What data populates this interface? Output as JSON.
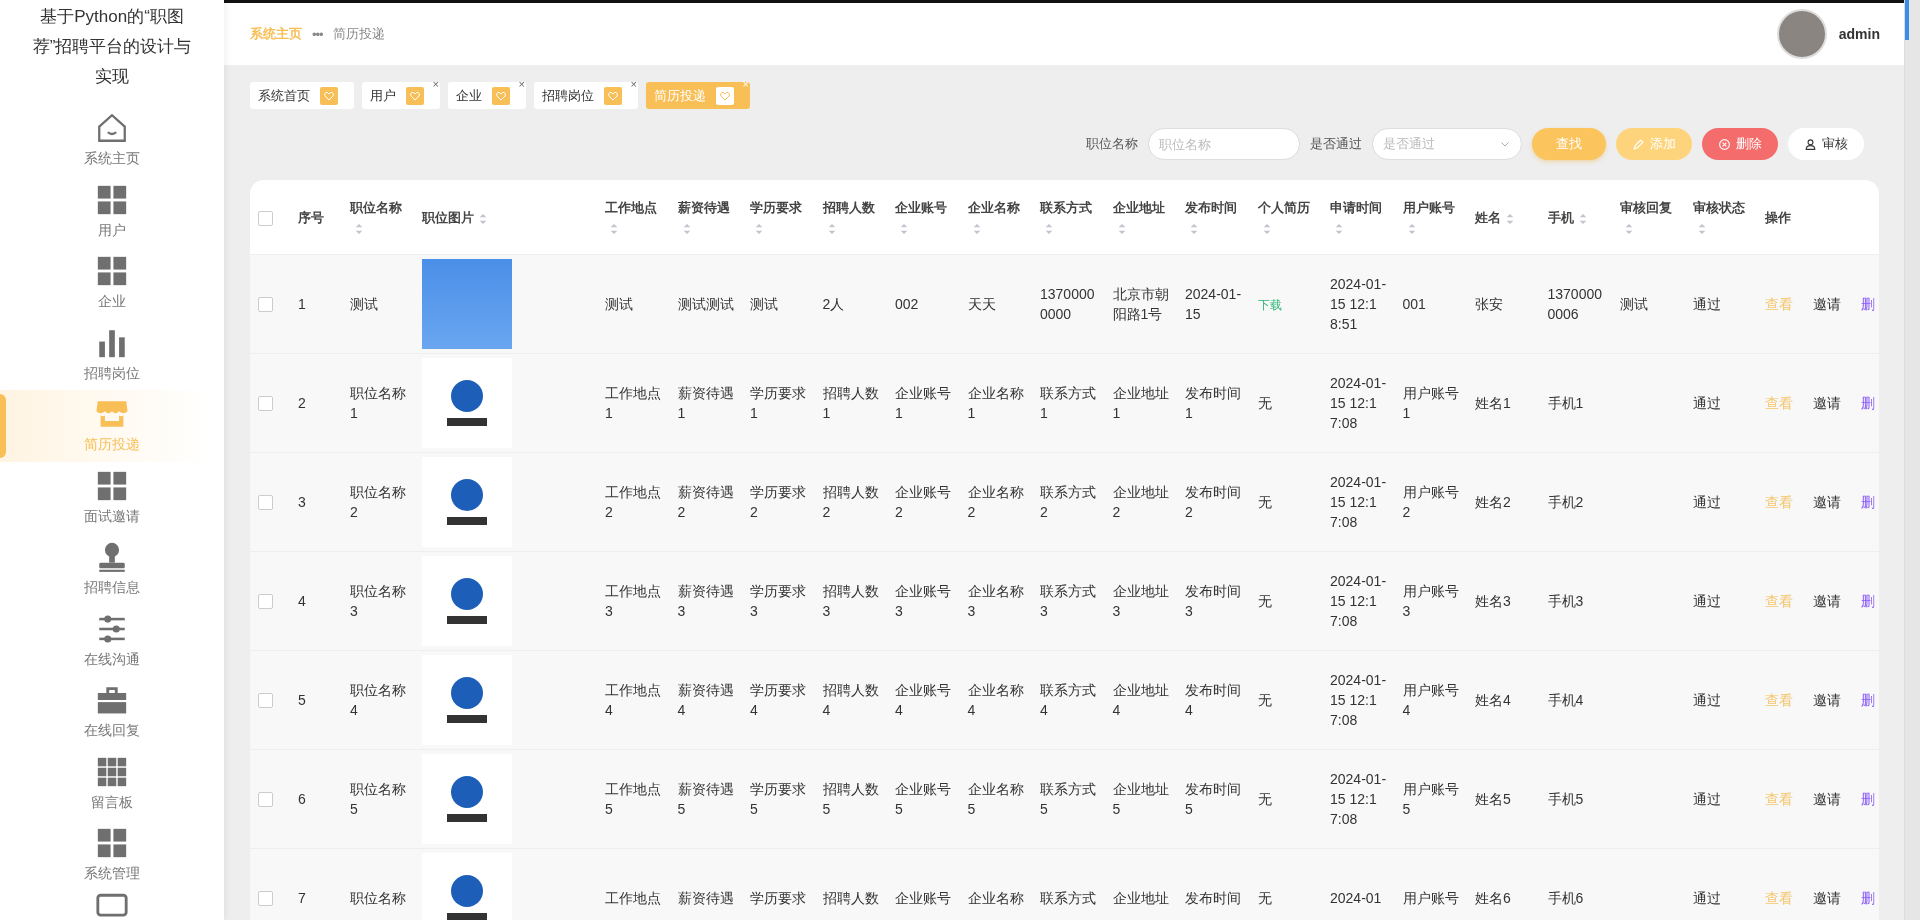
{
  "sidebar": {
    "title": "基于Python的“职图荐”招聘平台的设计与实现",
    "items": [
      {
        "label": "系统主页",
        "selected": false
      },
      {
        "label": "用户",
        "selected": false
      },
      {
        "label": "企业",
        "selected": false
      },
      {
        "label": "招聘岗位",
        "selected": false
      },
      {
        "label": "简历投递",
        "selected": true
      },
      {
        "label": "面试邀请",
        "selected": false
      },
      {
        "label": "招聘信息",
        "selected": false
      },
      {
        "label": "在线沟通",
        "selected": false
      },
      {
        "label": "在线回复",
        "selected": false
      },
      {
        "label": "留言板",
        "selected": false
      },
      {
        "label": "系统管理",
        "selected": false
      },
      {
        "selected": false
      }
    ]
  },
  "header": {
    "breadcrumb": [
      "系统主页",
      "•••",
      "简历投递"
    ],
    "user": "admin"
  },
  "tags": [
    {
      "label": "系统首页",
      "selected": false
    },
    {
      "label": "用户",
      "close": "×",
      "selected": false
    },
    {
      "label": "企业",
      "close": "×",
      "selected": false
    },
    {
      "label": "招聘岗位",
      "close": "×",
      "selected": false
    },
    {
      "label": "简历投递",
      "close": "×",
      "selected": true
    }
  ],
  "search": {
    "fields": [
      {
        "label": "职位名称",
        "placeholder": "职位名称",
        "kind": "input"
      },
      {
        "label": "是否通过",
        "placeholder": "是否通过",
        "kind": "select"
      }
    ],
    "buttons": [
      {
        "label": "查找",
        "kind": "search"
      },
      {
        "label": "添加",
        "kind": "add"
      },
      {
        "label": "删除",
        "kind": "delete"
      },
      {
        "label": "审核",
        "kind": "review"
      }
    ]
  },
  "table": {
    "all_checked": false,
    "columns": [
      {
        "label": "序号",
        "sortable": false
      },
      {
        "label": "职位名称",
        "sortable": true
      },
      {
        "label": "职位图片",
        "sortable": true
      },
      {
        "label": "工作地点",
        "sortable": true
      },
      {
        "label": "薪资待遇",
        "sortable": true
      },
      {
        "label": "学历要求",
        "sortable": true
      },
      {
        "label": "招聘人数",
        "sortable": true
      },
      {
        "label": "企业账号",
        "sortable": true
      },
      {
        "label": "企业名称",
        "sortable": true
      },
      {
        "label": "联系方式",
        "sortable": true
      },
      {
        "label": "企业地址",
        "sortable": true
      },
      {
        "label": "发布时间",
        "sortable": true
      },
      {
        "label": "个人简历",
        "sortable": true
      },
      {
        "label": "申请时间",
        "sortable": true
      },
      {
        "label": "用户账号",
        "sortable": true
      },
      {
        "label": "姓名",
        "sortable": true
      },
      {
        "label": "手机",
        "sortable": true
      },
      {
        "label": "审核回复",
        "sortable": true
      },
      {
        "label": "审核状态",
        "sortable": true
      },
      {
        "label": "操作",
        "sortable": false
      }
    ],
    "rows": [
      {
        "checked": false,
        "cells": [
          "1",
          "测试",
          {
            "kind": "photo"
          },
          "测试",
          "测试测试",
          "测试",
          "2人",
          "002",
          "天天",
          "13700000000",
          "北京市朝阳路1号",
          "2024-01-15",
          {
            "kind": "link",
            "text": "下载"
          },
          "2024-01-15 12:18:51",
          "001",
          "张安",
          "13700000006",
          "测试",
          "通过"
        ],
        "actions": [
          {
            "label": "查看",
            "kind": "view"
          },
          {
            "label": "邀请",
            "kind": "invite"
          },
          {
            "label": "删",
            "kind": "delete"
          }
        ]
      },
      {
        "checked": false,
        "cells": [
          "2",
          "职位名称1",
          {
            "kind": "logo"
          },
          "工作地点1",
          "薪资待遇1",
          "学历要求1",
          "招聘人数1",
          "企业账号1",
          "企业名称1",
          "联系方式1",
          "企业地址1",
          "发布时间1",
          "无",
          "2024-01-15 12:17:08",
          "用户账号1",
          "姓名1",
          "手机1",
          null,
          "通过"
        ],
        "actions": [
          {
            "label": "查看",
            "kind": "view"
          },
          {
            "label": "邀请",
            "kind": "invite"
          },
          {
            "label": "删",
            "kind": "delete"
          }
        ]
      },
      {
        "checked": false,
        "cells": [
          "3",
          "职位名称2",
          {
            "kind": "logo"
          },
          "工作地点2",
          "薪资待遇2",
          "学历要求2",
          "招聘人数2",
          "企业账号2",
          "企业名称2",
          "联系方式2",
          "企业地址2",
          "发布时间2",
          "无",
          "2024-01-15 12:17:08",
          "用户账号2",
          "姓名2",
          "手机2",
          null,
          "通过"
        ],
        "actions": [
          {
            "label": "查看",
            "kind": "view"
          },
          {
            "label": "邀请",
            "kind": "invite"
          },
          {
            "label": "删",
            "kind": "delete"
          }
        ]
      },
      {
        "checked": false,
        "cells": [
          "4",
          "职位名称3",
          {
            "kind": "logo"
          },
          "工作地点3",
          "薪资待遇3",
          "学历要求3",
          "招聘人数3",
          "企业账号3",
          "企业名称3",
          "联系方式3",
          "企业地址3",
          "发布时间3",
          "无",
          "2024-01-15 12:17:08",
          "用户账号3",
          "姓名3",
          "手机3",
          null,
          "通过"
        ],
        "actions": [
          {
            "label": "查看",
            "kind": "view"
          },
          {
            "label": "邀请",
            "kind": "invite"
          },
          {
            "label": "删",
            "kind": "delete"
          }
        ]
      },
      {
        "checked": false,
        "cells": [
          "5",
          "职位名称4",
          {
            "kind": "logo"
          },
          "工作地点4",
          "薪资待遇4",
          "学历要求4",
          "招聘人数4",
          "企业账号4",
          "企业名称4",
          "联系方式4",
          "企业地址4",
          "发布时间4",
          "无",
          "2024-01-15 12:17:08",
          "用户账号4",
          "姓名4",
          "手机4",
          null,
          "通过"
        ],
        "actions": [
          {
            "label": "查看",
            "kind": "view"
          },
          {
            "label": "邀请",
            "kind": "invite"
          },
          {
            "label": "删",
            "kind": "delete"
          }
        ]
      },
      {
        "checked": false,
        "cells": [
          "6",
          "职位名称5",
          {
            "kind": "logo"
          },
          "工作地点5",
          "薪资待遇5",
          "学历要求5",
          "招聘人数5",
          "企业账号5",
          "企业名称5",
          "联系方式5",
          "企业地址5",
          "发布时间5",
          "无",
          "2024-01-15 12:17:08",
          "用户账号5",
          "姓名5",
          "手机5",
          null,
          "通过"
        ],
        "actions": [
          {
            "label": "查看",
            "kind": "view"
          },
          {
            "label": "邀请",
            "kind": "invite"
          },
          {
            "label": "删",
            "kind": "delete"
          }
        ]
      },
      {
        "checked": false,
        "cells": [
          "7",
          "职位名称",
          {
            "kind": "logo"
          },
          "工作地点",
          "薪资待遇",
          "学历要求",
          "招聘人数",
          "企业账号",
          "企业名称",
          "联系方式",
          "企业地址",
          "发布时间",
          "无",
          "2024-01",
          "用户账号",
          "姓名6",
          "手机6",
          null,
          "通过"
        ],
        "actions": [
          {
            "label": "查看",
            "kind": "view"
          },
          {
            "label": "邀请",
            "kind": "invite"
          },
          {
            "label": "删",
            "kind": "delete"
          }
        ]
      }
    ]
  }
}
